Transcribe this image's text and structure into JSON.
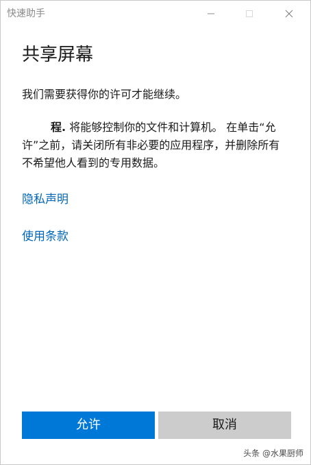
{
  "window": {
    "title": "快速助手"
  },
  "main": {
    "page_title": "共享屏幕",
    "permission_text": "我们需要获得你的许可才能继续。",
    "app_name": "程.",
    "description": "将能够控制你的文件和计算机。 在单击“允许”之前，请关闭所有非必要的应用程序，并删除所有不希望他人看到的专用数据。",
    "privacy_link": "隐私声明",
    "terms_link": "使用条款"
  },
  "actions": {
    "allow_label": "允许",
    "cancel_label": "取消"
  },
  "watermark": {
    "text": "头条 @水果厨师"
  },
  "colors": {
    "accent": "#0078d7",
    "link": "#0067b8",
    "secondary_button": "#cccccc"
  },
  "icons": {
    "minimize": "minimize-icon",
    "maximize": "maximize-icon",
    "close": "close-icon"
  }
}
